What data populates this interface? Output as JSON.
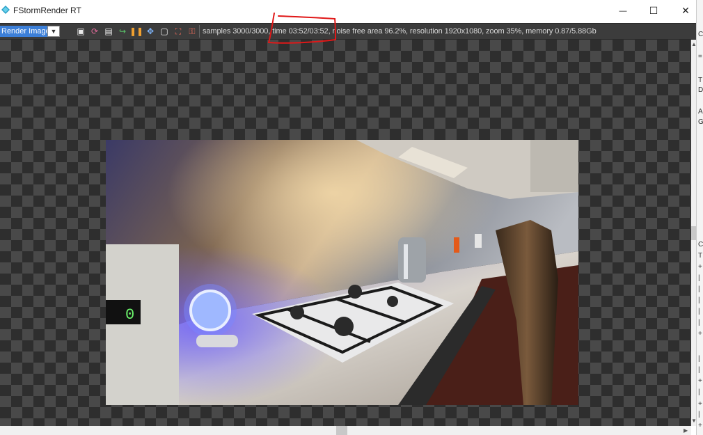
{
  "window": {
    "title": "FStormRender RT",
    "minimize_glyph": "—",
    "maximize_glyph": "☐",
    "close_glyph": "✕"
  },
  "toolbar": {
    "render_select_value": "Render Image",
    "tools": [
      {
        "name": "save-image-icon",
        "glyph": "▣",
        "color": "#e8e8e8"
      },
      {
        "name": "refresh-icon",
        "glyph": "⟳",
        "color": "#e26b9b"
      },
      {
        "name": "disk-icon",
        "glyph": "▤",
        "color": "#f0f0f0"
      },
      {
        "name": "export-icon",
        "glyph": "↪",
        "color": "#5ac46a"
      },
      {
        "name": "pause-icon",
        "glyph": "❚❚",
        "color": "#f0a030"
      },
      {
        "name": "fit-icon",
        "glyph": "✥",
        "color": "#7fb7ff"
      },
      {
        "name": "region-icon",
        "glyph": "▢",
        "color": "#ededed"
      },
      {
        "name": "crop-icon",
        "glyph": "⛶",
        "color": "#e56a5a"
      },
      {
        "name": "lock-icon",
        "glyph": "⚿",
        "color": "#e56a5a"
      }
    ]
  },
  "status": {
    "text": "samples 3000/3000,  time 03:52/03:52,  noise free area 96.2%,  resolution 1920x1080,  zoom 35%,  memory 0.87/5.88Gb"
  },
  "scroll": {
    "up": "▲",
    "down": "▼",
    "left": "◀",
    "right": "▶"
  },
  "right_strip": [
    "C",
    "=",
    "T",
    "D",
    "A",
    "G",
    "C",
    "T",
    "+",
    "|",
    "|",
    "|",
    "|",
    "|",
    "+",
    "|",
    "|",
    "+",
    "|",
    "+",
    "|",
    "+"
  ]
}
